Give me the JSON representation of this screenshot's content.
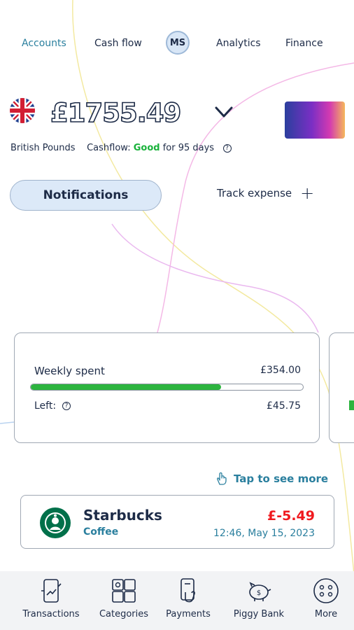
{
  "colors": {
    "accent": "#2a7f9e",
    "dark": "#1d2b47",
    "good": "#19b23b",
    "negative": "#f0191e",
    "progress": "#2db43f"
  },
  "nav": {
    "tabs": [
      {
        "label": "Accounts"
      },
      {
        "label": "Cash flow"
      },
      {
        "label": "Analytics"
      },
      {
        "label": "Finance"
      }
    ],
    "avatar_initials": "MS"
  },
  "balance": {
    "amount": "£1755.49",
    "currency_name": "British Pounds",
    "cashflow_prefix": "Cashflow:",
    "cashflow_status": "Good",
    "cashflow_suffix": "for 95 days",
    "help_glyph": "?"
  },
  "actions": {
    "notifications_label": "Notifications",
    "track_expense_label": "Track expense",
    "track_plus": "+"
  },
  "weekly": {
    "title": "Weekly spent",
    "spent": "£354.00",
    "left_label": "Left:",
    "left_amount": "£45.75",
    "progress_fraction": 0.7
  },
  "hint": {
    "tap_label": "Tap to see more"
  },
  "transaction": {
    "merchant": "Starbucks",
    "category": "Coffee",
    "amount": "£-5.49",
    "datetime": "12:46, May 15, 2023"
  },
  "bottom_nav": [
    {
      "label": "Transactions",
      "icon": "transactions-icon"
    },
    {
      "label": "Categories",
      "icon": "categories-icon"
    },
    {
      "label": "Payments",
      "icon": "payments-icon"
    },
    {
      "label": "Piggy Bank",
      "icon": "piggy-bank-icon"
    },
    {
      "label": "More",
      "icon": "more-icon"
    }
  ]
}
